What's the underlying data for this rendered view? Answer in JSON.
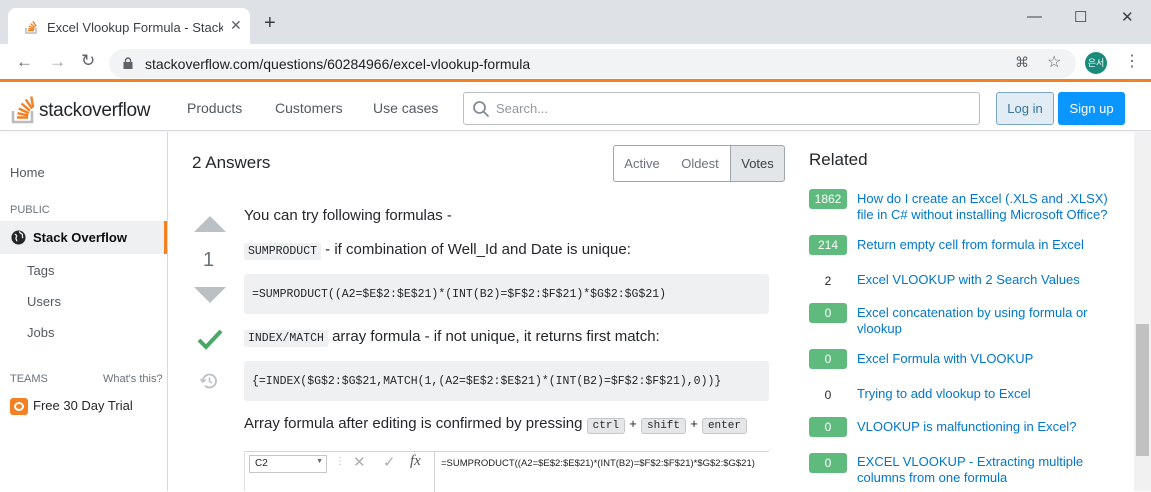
{
  "browser": {
    "tab_title": "Excel Vlookup Formula - Stack O",
    "url": "stackoverflow.com/questions/60284966/excel-vlookup-formula",
    "profile": "은서"
  },
  "header": {
    "logo_text": "stackoverflow",
    "nav": [
      "Products",
      "Customers",
      "Use cases"
    ],
    "search_placeholder": "Search...",
    "login": "Log in",
    "signup": "Sign up"
  },
  "sidebar": {
    "home": "Home",
    "public": "PUBLIC",
    "stackoverflow": "Stack Overflow",
    "tags": "Tags",
    "users": "Users",
    "jobs": "Jobs",
    "teams": "TEAMS",
    "whats_this": "What's this?",
    "trial": "Free 30 Day Trial"
  },
  "answers": {
    "count_label": "2 Answers",
    "filters": [
      "Active",
      "Oldest",
      "Votes"
    ],
    "vote": "1"
  },
  "answer": {
    "p1": "You can try following formulas -",
    "c1": "SUMPRODUCT",
    "p2": " - if combination of Well_Id and Date is unique:",
    "code1": "=SUMPRODUCT((A2=$E$2:$E$21)*(INT(B2)=$F$2:$F$21)*$G$2:$G$21)",
    "c2": "INDEX/MATCH",
    "p3": " array formula - if not unique, it returns first match:",
    "code2": "{=INDEX($G$2:$G$21,MATCH(1,(A2=$E$2:$E$21)*(INT(B2)=$F$2:$F$21),0))}",
    "p4": "Array formula after editing is confirmed by pressing",
    "k1": "ctrl",
    "plus": "+",
    "k2": "shift",
    "k3": "enter",
    "excel_cell": "C2",
    "excel_fx": "fx",
    "excel_formula": "=SUMPRODUCT((A2=$E$2:$E$21)*(INT(B2)=$F$2:$F$21)*$G$2:$G$21)"
  },
  "related": {
    "title": "Related",
    "items": [
      {
        "score": "1862",
        "text": "How do I create an Excel (.XLS and .XLSX) file in C# without installing Microsoft Office?",
        "accepted": true
      },
      {
        "score": "214",
        "text": "Return empty cell from formula in Excel",
        "accepted": true
      },
      {
        "score": "2",
        "text": "Excel VLOOKUP with 2 Search Values",
        "accepted": false
      },
      {
        "score": "0",
        "text": "Excel concatenation by using formula or vlookup",
        "accepted": true
      },
      {
        "score": "0",
        "text": "Excel Formula with VLOOKUP",
        "accepted": true
      },
      {
        "score": "0",
        "text": "Trying to add vlookup to Excel",
        "accepted": false
      },
      {
        "score": "0",
        "text": "VLOOKUP is malfunctioning in Excel?",
        "accepted": true
      },
      {
        "score": "0",
        "text": "EXCEL VLOOKUP - Extracting multiple columns from one formula",
        "accepted": true
      }
    ]
  },
  "colors": {
    "accent": "#f48024",
    "link": "#0077cc",
    "accepted": "#5eba7d",
    "primary": "#0a95ff"
  }
}
